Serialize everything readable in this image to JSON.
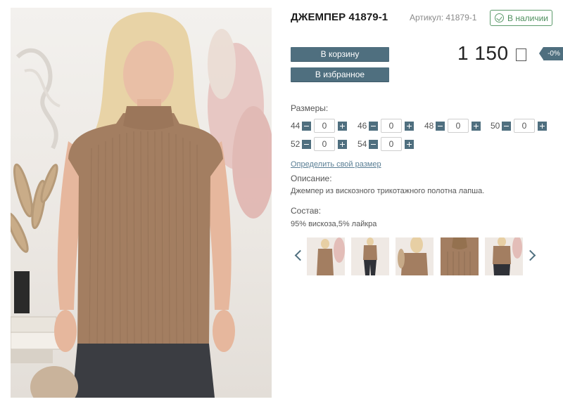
{
  "product": {
    "title": "ДЖЕМПЕР 41879-1",
    "sku_label": "Артикул: 41879-1",
    "availability": "В наличии",
    "price": "1 150",
    "discount": "-0%",
    "buttons": {
      "cart": "В корзину",
      "favorites": "В избранное"
    }
  },
  "sizes": {
    "label": "Размеры:",
    "items": [
      {
        "size": "44",
        "qty": "0"
      },
      {
        "size": "46",
        "qty": "0"
      },
      {
        "size": "48",
        "qty": "0"
      },
      {
        "size": "50",
        "qty": "0"
      },
      {
        "size": "52",
        "qty": "0"
      },
      {
        "size": "54",
        "qty": "0"
      }
    ],
    "size_link": "Определить свой размер"
  },
  "description": {
    "label": "Описание:",
    "text": "Джемпер из вискозного трикотажного полотна лапша."
  },
  "composition": {
    "label": "Состав:",
    "text": "95% вискоза,5% лайкра"
  },
  "colors": {
    "button": "#4f6f7f",
    "in_stock": "#5c9a6b",
    "product": "#a37e61",
    "link": "#5b7f95"
  }
}
